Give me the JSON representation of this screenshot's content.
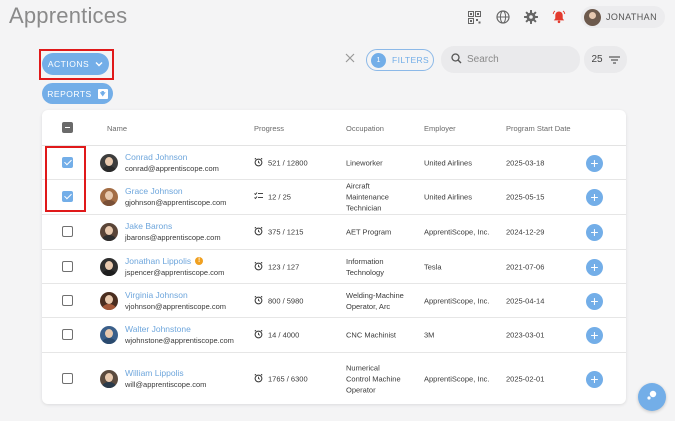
{
  "page": {
    "title": "Apprentices"
  },
  "topbar": {
    "icons": [
      "qr-code-icon",
      "globe-icon",
      "gear-icon",
      "bell-icon"
    ],
    "user_name": "JONATHAN"
  },
  "toolbar": {
    "actions_label": "ACTIONS",
    "reports_label": "REPORTS",
    "filters_count": "1",
    "filters_label": "FILTERS",
    "search_placeholder": "Search",
    "page_size": "25"
  },
  "colors": {
    "accent": "#73aee8",
    "highlight": "#e0191a",
    "warning": "#f0a020"
  },
  "table": {
    "columns": [
      "Name",
      "Progress",
      "Occupation",
      "Employer",
      "Program Start Date"
    ],
    "rows": [
      {
        "name": "Conrad Johnson",
        "email": "conrad@apprentiscope.com",
        "progress": "521 / 12800",
        "progress_icon": "alarm-clock-icon",
        "occupation": "Lineworker",
        "employer": "United Airlines",
        "start_date": "2025-03-18",
        "checked": true,
        "warning": false
      },
      {
        "name": "Grace Johnson",
        "email": "gjohnson@apprentiscope.com",
        "progress": "12 / 25",
        "progress_icon": "checklist-icon",
        "occupation": "Aircraft Maintenance Technician",
        "employer": "United Airlines",
        "start_date": "2025-05-15",
        "checked": true,
        "warning": false
      },
      {
        "name": "Jake Barons",
        "email": "jbarons@apprentiscope.com",
        "progress": "375 / 1215",
        "progress_icon": "alarm-clock-icon",
        "occupation": "AET Program",
        "employer": "ApprentiScope, Inc.",
        "start_date": "2024-12-29",
        "checked": false,
        "warning": false
      },
      {
        "name": "Jonathan Lippolis",
        "email": "jspencer@apprentiscope.com",
        "progress": "123 / 127",
        "progress_icon": "alarm-clock-icon",
        "occupation": "Information Technology",
        "employer": "Tesla",
        "start_date": "2021-07-06",
        "checked": false,
        "warning": true
      },
      {
        "name": "Virginia Johnson",
        "email": "vjohnson@apprentiscope.com",
        "progress": "800 / 5980",
        "progress_icon": "alarm-clock-icon",
        "occupation": "Welding-Machine Operator, Arc",
        "employer": "ApprentiScope, Inc.",
        "start_date": "2025-04-14",
        "checked": false,
        "warning": false
      },
      {
        "name": "Walter Johnstone",
        "email": "wjohnstone@apprentiscope.com",
        "progress": "14 / 4000",
        "progress_icon": "alarm-clock-icon",
        "occupation": "CNC Machinist",
        "employer": "3M",
        "start_date": "2023-03-01",
        "checked": false,
        "warning": false
      },
      {
        "name": "William Lippolis",
        "email": "will@apprentiscope.com",
        "progress": "1765 / 6300",
        "progress_icon": "alarm-clock-icon",
        "occupation": "Numerical Control Machine Operator",
        "employer": "ApprentiScope, Inc.",
        "start_date": "2025-02-01",
        "checked": false,
        "warning": false
      }
    ]
  }
}
